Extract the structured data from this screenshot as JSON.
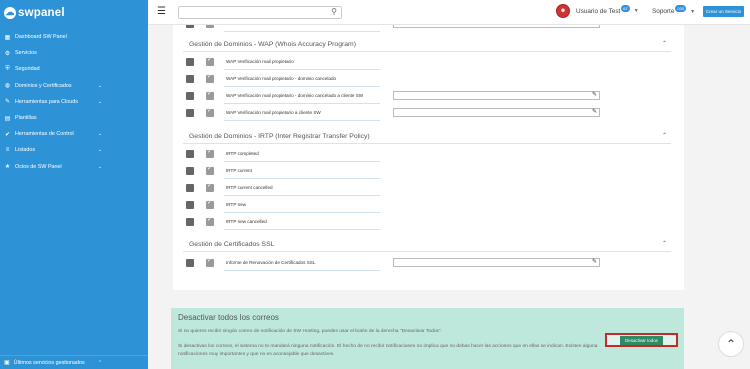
{
  "sidebar": {
    "logo": "swpanel",
    "items": [
      {
        "label": "Dashboard SW Panel",
        "icon": "grid-icon",
        "chev": false
      },
      {
        "label": "Servicios",
        "icon": "gear-icon",
        "chev": false
      },
      {
        "label": "Seguridad",
        "icon": "shield-icon",
        "chev": false
      },
      {
        "label": "Dominios y Certificados",
        "icon": "globe-icon",
        "chev": true
      },
      {
        "label": "Herramientas para Clouds",
        "icon": "wrench-icon",
        "chev": true
      },
      {
        "label": "Plantillas",
        "icon": "file-icon",
        "chev": false
      },
      {
        "label": "Herramientas de Control",
        "icon": "check-circle-icon",
        "chev": true
      },
      {
        "label": "Listados",
        "icon": "list-icon",
        "chev": true
      },
      {
        "label": "Ocios de SW Panel",
        "icon": "star-icon",
        "chev": true
      }
    ],
    "footer": "Últimos servicios gestionados"
  },
  "topbar": {
    "search_placeholder": "",
    "user_name": "Usuario de Test",
    "user_badge": "67",
    "support_label": "Soporte",
    "support_badge": "000",
    "create_label": "Crear un Servicio"
  },
  "sections": [
    {
      "title": "Gestión de Dominios - WAP (Whois Accuracy Program)",
      "rows": [
        {
          "label": "WAP Verificación mail propietario",
          "input": false
        },
        {
          "label": "WAP Verificación mail propietario - dominio cancelado",
          "input": false
        },
        {
          "label": "WAP Verificación mail propietario - dominio cancelado a cliente SW",
          "input": true
        },
        {
          "label": "WAP Verificación mail propietario a cliente SW",
          "input": true
        }
      ]
    },
    {
      "title": "Gestión de Dominios - IRTP (Inter Registrar Transfer Policy)",
      "rows": [
        {
          "label": "IRTP completed",
          "input": false
        },
        {
          "label": "IRTP current",
          "input": false
        },
        {
          "label": "IRTP current cancelled",
          "input": false
        },
        {
          "label": "IRTP new",
          "input": false
        },
        {
          "label": "IRTP new cancelled",
          "input": false
        }
      ]
    },
    {
      "title": "Gestión de Certificados SSL",
      "rows": [
        {
          "label": "Informe de Renovación de Certificados SSL",
          "input": true
        }
      ]
    }
  ],
  "info": {
    "title": "Desactivar todos los correos",
    "p1": "Si no quieres recibir ningún correo de notificación de SW Hosting, puedes usar el botón de la derecha \"Desactivar Todos\".",
    "p2": "Si desactivas los correos, el sistema no te mandará ninguna notificación. El hecho de no recibir notificaciones no implica que no debas hacer las acciones que en ellas se indican. Existen alguna notificaciones muy importantes y que no es aconsejable que desactives.",
    "button": "Desactivar todos"
  },
  "colors": {
    "sidebar": "#2e92d6",
    "info_bg": "#bfe8dc",
    "button": "#2e8b63",
    "highlight": "#c62828"
  }
}
